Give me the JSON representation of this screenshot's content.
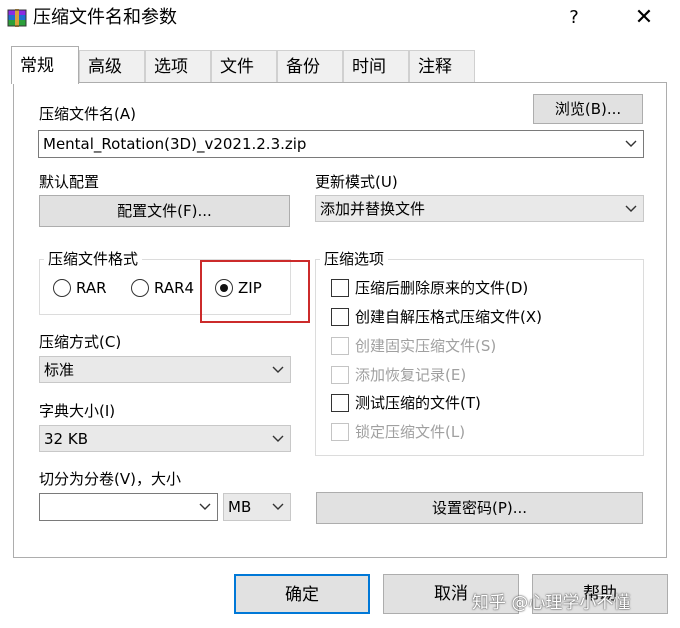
{
  "window": {
    "title": "压缩文件名和参数",
    "help_glyph": "?",
    "close_glyph": "✕"
  },
  "tabs": [
    {
      "label": "常规",
      "active": true
    },
    {
      "label": "高级"
    },
    {
      "label": "选项"
    },
    {
      "label": "文件"
    },
    {
      "label": "备份"
    },
    {
      "label": "时间"
    },
    {
      "label": "注释"
    }
  ],
  "archive_name": {
    "label": "压缩文件名(A)",
    "value": "Mental_Rotation(3D)_v2021.2.3.zip",
    "browse_label": "浏览(B)..."
  },
  "default_profile": {
    "label": "默认配置",
    "button_label": "配置文件(F)..."
  },
  "update_mode": {
    "label": "更新模式(U)",
    "value": "添加并替换文件"
  },
  "archive_format": {
    "title": "压缩文件格式",
    "options": [
      "RAR",
      "RAR4",
      "ZIP"
    ],
    "selected": "ZIP"
  },
  "compression_options": {
    "title": "压缩选项",
    "items": [
      {
        "label": "压缩后删除原来的文件(D)",
        "checked": false,
        "enabled": true
      },
      {
        "label": "创建自解压格式压缩文件(X)",
        "checked": false,
        "enabled": true
      },
      {
        "label": "创建固实压缩文件(S)",
        "checked": false,
        "enabled": false
      },
      {
        "label": "添加恢复记录(E)",
        "checked": false,
        "enabled": false
      },
      {
        "label": "测试压缩的文件(T)",
        "checked": false,
        "enabled": true
      },
      {
        "label": "锁定压缩文件(L)",
        "checked": false,
        "enabled": false
      }
    ]
  },
  "compression_method": {
    "label": "压缩方式(C)",
    "value": "标准"
  },
  "dictionary_size": {
    "label": "字典大小(I)",
    "value": "32 KB"
  },
  "split_volumes": {
    "label": "切分为分卷(V)，大小",
    "value": "",
    "unit": "MB"
  },
  "set_password_label": "设置密码(P)...",
  "footer": {
    "ok_label": "确定",
    "cancel_label": "取消",
    "help_label": "帮助"
  },
  "watermark": "知乎 @心理学小不懂",
  "colors": {
    "highlight": "#cc2b2b",
    "focus_border": "#0078d7"
  }
}
